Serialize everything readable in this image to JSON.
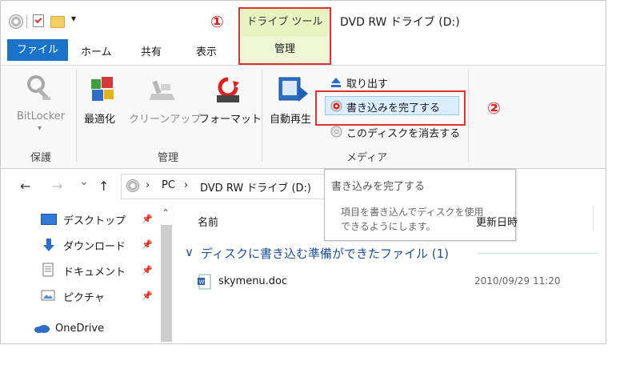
{
  "title_bar": {
    "window_title": "DVD RW ドライブ (D:)",
    "qat_dropdown": "▾"
  },
  "ribbon_tabs": {
    "file": "ファイル",
    "home": "ホーム",
    "share": "共有",
    "view": "表示",
    "context_header": "ドライブ ツール",
    "manage": "管理"
  },
  "annotations": {
    "marker_1": "①",
    "marker_2": "②"
  },
  "ribbon": {
    "bitlocker": {
      "label": "BitLocker",
      "arrow": "▾"
    },
    "group_protect": "保護",
    "optimize": "最適化",
    "cleanup": "クリーンアップ",
    "format": "フォーマット",
    "group_manage": "管理",
    "autoplay": "自動再生",
    "eject": "取り出す",
    "finish_burning": "書き込みを完了する",
    "erase_disc": "このディスクを消去する",
    "group_media": "メディア"
  },
  "tooltip": {
    "title": "書き込みを完了する",
    "body_line1": "項目を書き込んでディスクを使用",
    "body_line2": "できるようにします。"
  },
  "address_bar": {
    "back": "←",
    "forward": "→",
    "recent": "⌄",
    "up": "↑",
    "crumb_sep_1": "›",
    "crumb_pc": "PC",
    "crumb_sep_2": "›",
    "crumb_drive": "DVD RW ドライブ (D:)"
  },
  "sidebar": {
    "items": [
      {
        "label": "デスクトップ"
      },
      {
        "label": "ダウンロード"
      },
      {
        "label": "ドキュメント"
      },
      {
        "label": "ピクチャ"
      }
    ],
    "onedrive": "OneDrive",
    "pin": "📌",
    "scroll_up": "⌃"
  },
  "file_list": {
    "col_name": "名前",
    "col_date": "更新日時",
    "group_header": "ディスクに書き込む準備ができたファイル (1)",
    "group_chevron": "∨",
    "files": [
      {
        "name": "skymenu.doc",
        "date": "2010/09/29 11:20"
      }
    ]
  },
  "colors": {
    "file_tab": "#1a73c8",
    "context_tab": "#e6f2bf",
    "annotation_red": "#e03030",
    "group_header_blue": "#1e4e9c"
  }
}
